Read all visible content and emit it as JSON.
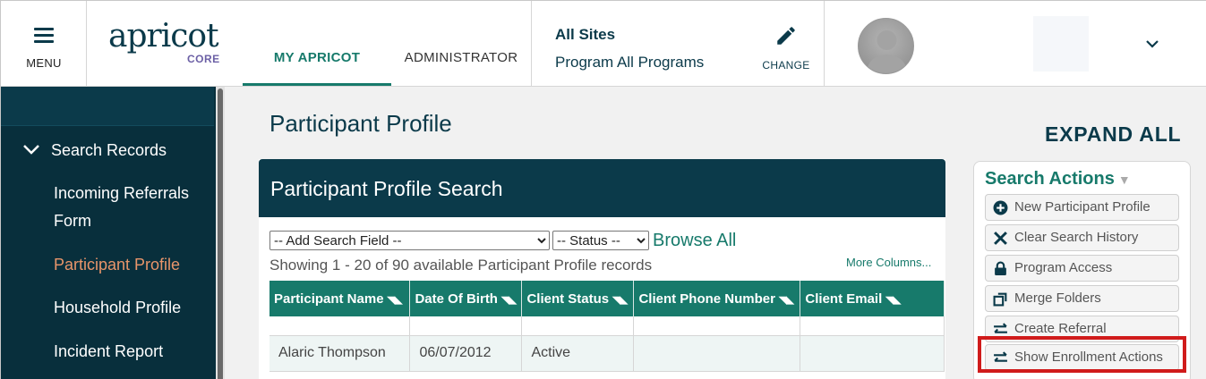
{
  "header": {
    "menu_label": "MENU",
    "logo_word": "apricot",
    "logo_sub": "CORE",
    "tabs": [
      {
        "label": "MY APRICOT",
        "active": true
      },
      {
        "label": "ADMINISTRATOR",
        "active": false
      }
    ],
    "site": {
      "title": "All Sites",
      "program": "Program All Programs",
      "change_label": "CHANGE"
    }
  },
  "sidebar": {
    "section": "Search Records",
    "items": [
      {
        "label": "Incoming Referrals",
        "label2": "Form"
      },
      {
        "label": "Participant Profile",
        "active": true
      },
      {
        "label": "Household Profile"
      },
      {
        "label": "Incident Report"
      }
    ]
  },
  "main": {
    "page_title": "Participant Profile",
    "expand_all": "EXPAND ALL",
    "card_title": "Participant Profile Search",
    "add_field_selected": "-- Add Search Field --",
    "status_selected": "-- Status --",
    "browse_all": "Browse All",
    "showing": "Showing 1 - 20 of 90 available Participant Profile records",
    "more_columns": "More Columns...",
    "columns": [
      "Participant Name",
      "Date Of Birth",
      "Client Status",
      "Client Phone Number",
      "Client Email"
    ],
    "rows": [
      [
        "Alaric Thompson",
        "06/07/2012",
        "Active",
        "",
        ""
      ]
    ]
  },
  "actions": {
    "title": "Search Actions",
    "buttons": [
      {
        "label": "New Participant Profile",
        "icon": "plus-circle-icon"
      },
      {
        "label": "Clear Search History",
        "icon": "x-icon"
      },
      {
        "label": "Program Access",
        "icon": "lock-icon"
      },
      {
        "label": "Merge Folders",
        "icon": "merge-icon"
      },
      {
        "label": "Create Referral",
        "icon": "arrows-icon"
      },
      {
        "label": "Show Enrollment Actions",
        "icon": "arrows-icon"
      }
    ]
  },
  "colors": {
    "navy": "#0b3a4a",
    "teal": "#177a6b",
    "highlight": "#d01b1b",
    "active_nav": "#e8956a"
  }
}
